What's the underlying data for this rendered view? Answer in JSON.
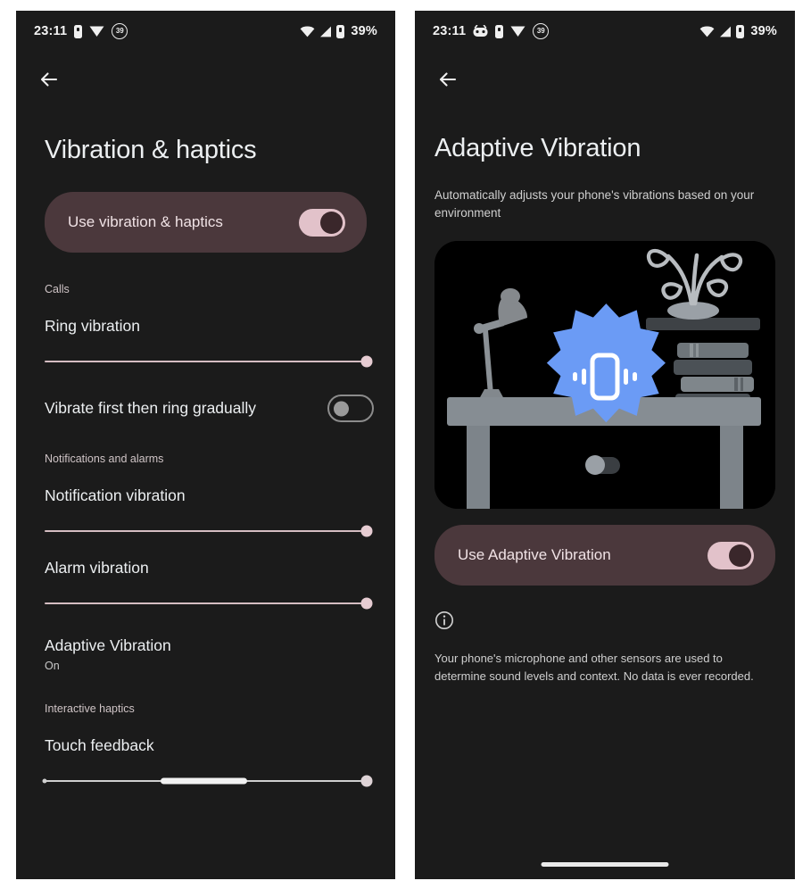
{
  "left": {
    "status_bar": {
      "time": "23:11",
      "battery_saver_badge": "39",
      "battery_percent": "39%",
      "icons": [
        "battery-icon",
        "vpn-icon",
        "battery-saver-badge",
        "wifi-icon",
        "cellular-signal-icon",
        "battery-icon"
      ]
    },
    "back_label": "Back",
    "title": "Vibration & haptics",
    "main_toggle": {
      "label": "Use vibration & haptics",
      "state": "on"
    },
    "sections": [
      {
        "header": "Calls",
        "rows": [
          {
            "kind": "slider",
            "title": "Ring vibration",
            "value": 100
          },
          {
            "kind": "switch",
            "title": "Vibrate first then ring gradually",
            "state": "off"
          }
        ]
      },
      {
        "header": "Notifications and alarms",
        "rows": [
          {
            "kind": "slider",
            "title": "Notification vibration",
            "value": 100
          },
          {
            "kind": "slider",
            "title": "Alarm vibration",
            "value": 100
          },
          {
            "kind": "link",
            "title": "Adaptive Vibration",
            "subtitle": "On"
          }
        ]
      },
      {
        "header": "Interactive haptics",
        "rows": [
          {
            "kind": "slider-segment",
            "title": "Touch feedback",
            "value": 100,
            "segment_start": 36,
            "segment_end": 63
          }
        ]
      }
    ]
  },
  "right": {
    "status_bar": {
      "time": "23:11",
      "battery_saver_badge": "39",
      "battery_percent": "39%",
      "icons": [
        "app-notification-icon",
        "battery-icon",
        "vpn-icon",
        "battery-saver-badge",
        "wifi-icon",
        "cellular-signal-icon",
        "battery-icon"
      ]
    },
    "back_label": "Back",
    "title": "Adaptive Vibration",
    "subtitle": "Automatically adjusts your phone's vibrations based on your environment",
    "illustration": {
      "name": "desk-with-vibrating-phone-illustration",
      "alt": "Desk with lamp, shelf with plant, stack of books and a blue starburst containing a vibrating phone icon",
      "accent": "#6b9bf5",
      "background": "#000000"
    },
    "main_toggle": {
      "label": "Use Adaptive Vibration",
      "state": "on"
    },
    "info": {
      "icon": "info-icon",
      "text": "Your phone's microphone and other sensors are used to determine sound levels and context. No data is ever recorded."
    }
  },
  "theme": {
    "screen_bg": "#1b1b1b",
    "card_bg": "#4b383c",
    "switch_on_track": "#e2c2ca",
    "switch_on_knob": "#3a272b",
    "slider_track": "#d5bdc2",
    "text_primary": "#eceff1",
    "text_secondary": "#cfcfcf"
  }
}
